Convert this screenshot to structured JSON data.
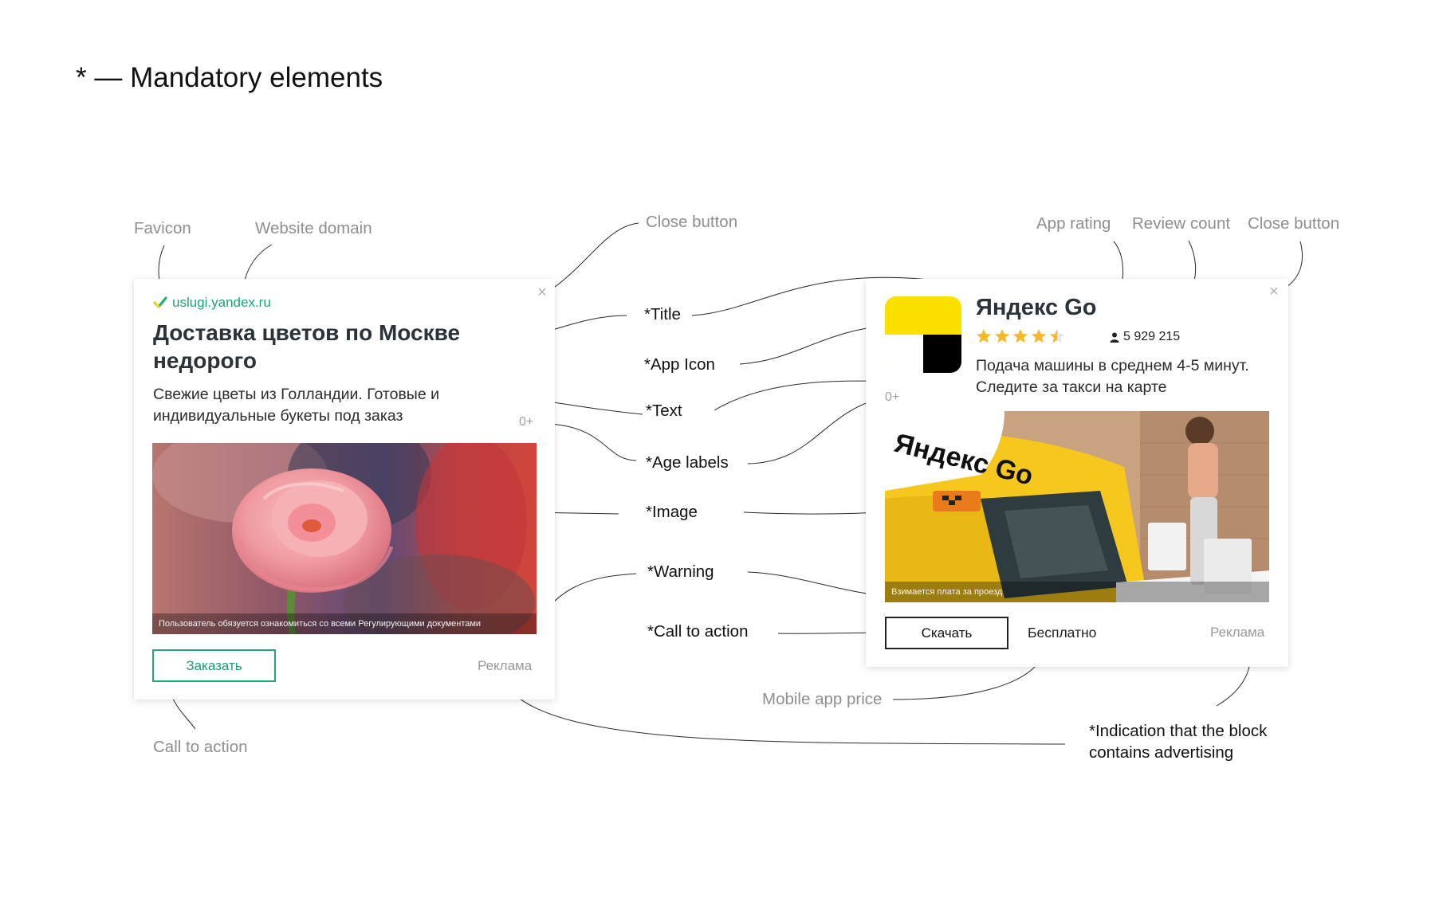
{
  "heading": "* — Mandatory elements",
  "callouts": {
    "favicon": "Favicon",
    "website_domain": "Website domain",
    "close_button_left": "Close button",
    "app_rating": "App rating",
    "review_count": "Review count",
    "close_button_right": "Close button",
    "mobile_app_price": "Mobile app price",
    "call_to_action_left": "Call to action"
  },
  "labels": {
    "title": "*Title",
    "app_icon": "*App Icon",
    "text": "*Text",
    "age_labels": "*Age labels",
    "image": "*Image",
    "warning": "*Warning",
    "call_to_action": "*Call to action",
    "ad_indication": "*Indication that the block contains advertising"
  },
  "left_ad": {
    "domain": "uslugi.yandex.ru",
    "title": "Доставка цветов по Москве недорого",
    "text": "Свежие цветы из Голландии. Готовые и индивидуальные букеты под заказ",
    "age": "0+",
    "warning": "Пользователь обязуется ознакомиться со всеми Регулирующими документами",
    "cta": "Заказать",
    "ad_label": "Реклама"
  },
  "right_ad": {
    "title": "Яндекс Go",
    "rating": 4.5,
    "reviews": "5 929 215",
    "text": "Подача машины в среднем 4-5 минут. Следите за такси на карте",
    "age": "0+",
    "image_sign_text": "Яндекс Go",
    "warning": "Взимается плата за проезд",
    "cta": "Скачать",
    "price": "Бесплатно",
    "ad_label": "Реклама"
  },
  "colors": {
    "accent_green": "#1aa37a",
    "taxi_yellow": "#f6c81e",
    "star_yellow": "#f5b92a",
    "callout_gray": "#8f8f8f"
  }
}
